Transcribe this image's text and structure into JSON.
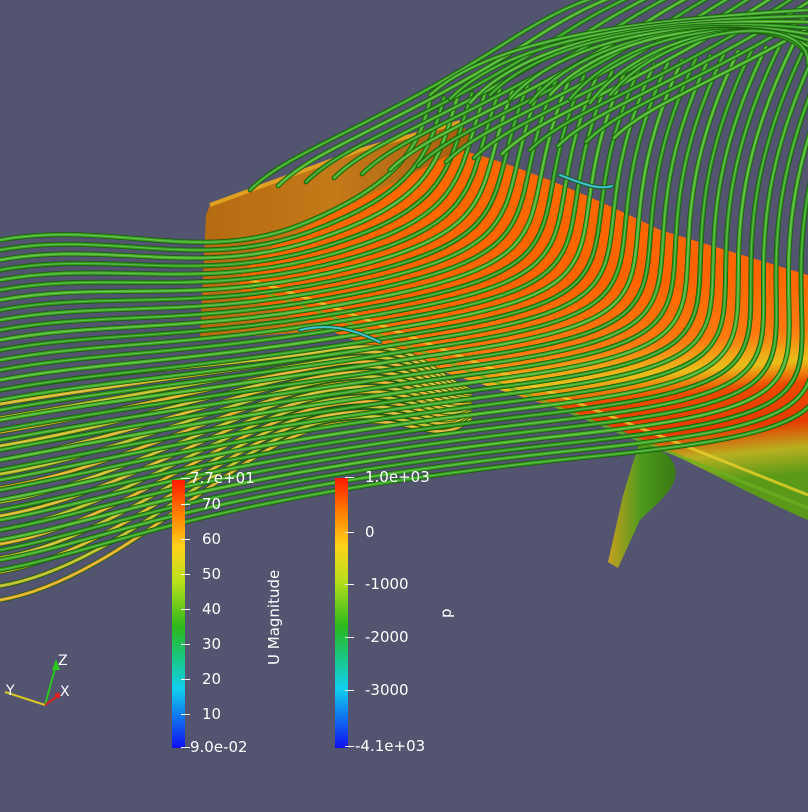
{
  "render_view": {
    "colors": {
      "background": "#525470",
      "surface": "#ff6a00",
      "streamline": "#2aa81c"
    }
  },
  "u_magnitude_bar": {
    "title": "U Magnitude",
    "max_label": "7.7e+01",
    "min_label": "9.0e-02",
    "ticks": [
      "70",
      "60",
      "50",
      "40",
      "30",
      "20",
      "10"
    ]
  },
  "p_bar": {
    "title": "p",
    "max_label": "1.0e+03",
    "min_label": "-4.1e+03",
    "ticks": [
      "0",
      "-1000",
      "-2000",
      "-3000"
    ]
  },
  "orientation_axes": {
    "z_label": "Z",
    "y_label": "Y",
    "x_label": "X"
  }
}
